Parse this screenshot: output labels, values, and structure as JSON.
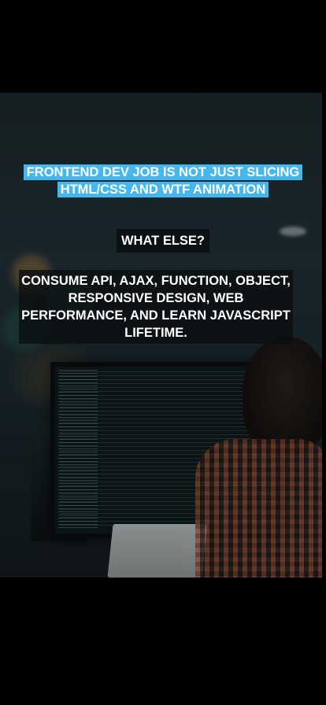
{
  "story": {
    "headline": "FRONTEND DEV JOB IS NOT JUST SLICING HTML/CSS AND WTF ANIMATION",
    "subheading": "WHAT ELSE?",
    "body": "CONSUME API, AJAX, FUNCTION, OBJECT, RESPONSIVE DESIGN, WEB PERFORMANCE, AND LEARN JAVASCRIPT LIFETIME.",
    "headline_highlight_color": "#44b7ee",
    "background_image": "developer-at-monitor-photo"
  }
}
